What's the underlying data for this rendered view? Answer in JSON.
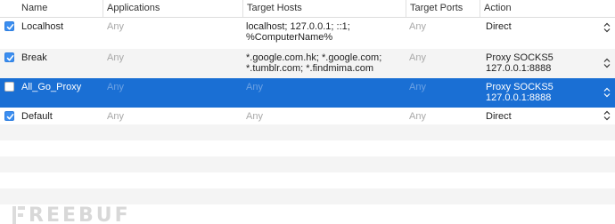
{
  "columns": {
    "name": "Name",
    "applications": "Applications",
    "target_hosts": "Target Hosts",
    "target_ports": "Target Ports",
    "action": "Action"
  },
  "rules": [
    {
      "enabled": true,
      "name": "Localhost",
      "applications": "Any",
      "target_hosts": "localhost; 127.0.0.1; ::1;\n%ComputerName%",
      "target_ports": "Any",
      "action": "Direct"
    },
    {
      "enabled": true,
      "name": "Break",
      "applications": "Any",
      "target_hosts": "*.google.com.hk; *.google.com;\n*.tumblr.com; *.findmima.com",
      "target_ports": "Any",
      "action": "Proxy SOCKS5\n127.0.0.1:8888"
    },
    {
      "enabled": false,
      "selected": true,
      "name": "All_Go_Proxy",
      "applications": "Any",
      "target_hosts": "Any",
      "target_ports": "Any",
      "action": "Proxy SOCKS5\n127.0.0.1:8888"
    },
    {
      "enabled": true,
      "name": "Default",
      "applications": "Any",
      "target_hosts": "Any",
      "target_ports": "Any",
      "action": "Direct"
    }
  ],
  "watermark": {
    "text": "REEBUF"
  },
  "icons": {
    "checkbox": "checkbox-icon",
    "stepper": "up-down-stepper-icon",
    "watermark": "freebuf-logo-icon"
  },
  "colors": {
    "selection": "#1a6fd4",
    "checkbox": "#3b8ef0",
    "stripe": "#f4f4f4",
    "muted_text": "#a8a8a8"
  }
}
